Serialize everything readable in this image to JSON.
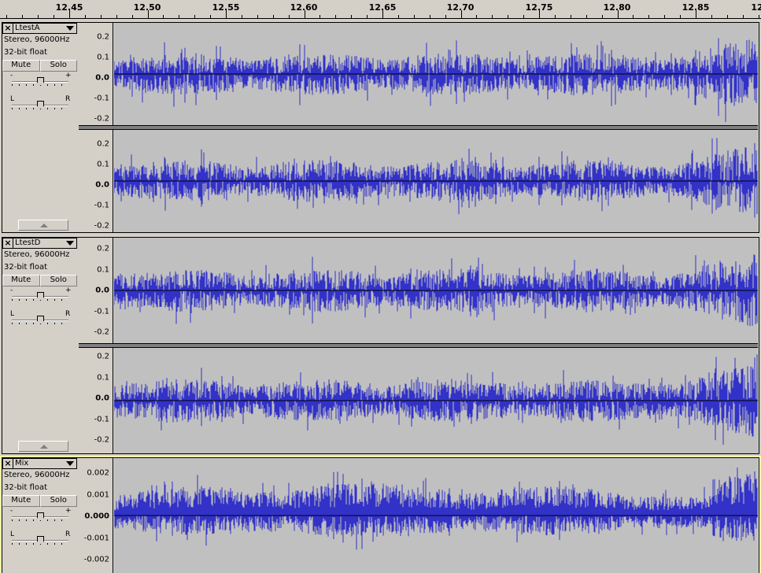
{
  "ruler": {
    "ticks": [
      "12.45",
      "12.50",
      "12.55",
      "12.60",
      "12.65",
      "12.70",
      "12.75",
      "12.80",
      "12.85",
      "12"
    ]
  },
  "tracks": [
    {
      "name": "LtestA",
      "info_line1": "Stereo, 96000Hz",
      "info_line2": "32-bit float",
      "mute_label": "Mute",
      "solo_label": "Solo",
      "gain_minus": "-",
      "gain_plus": "+",
      "pan_left": "L",
      "pan_right": "R",
      "channel_scale": [
        "0.2",
        "0.1",
        "0.0",
        "-0.1",
        "-0.2"
      ]
    },
    {
      "name": "LtestD",
      "info_line1": "Stereo, 96000Hz",
      "info_line2": "32-bit float",
      "mute_label": "Mute",
      "solo_label": "Solo",
      "gain_minus": "-",
      "gain_plus": "+",
      "pan_left": "L",
      "pan_right": "R",
      "channel_scale": [
        "0.2",
        "0.1",
        "0.0",
        "-0.1",
        "-0.2"
      ]
    },
    {
      "name": "Mix",
      "info_line1": "Stereo, 96000Hz",
      "info_line2": "32-bit float",
      "mute_label": "Mute",
      "solo_label": "Solo",
      "gain_minus": "-",
      "gain_plus": "+",
      "pan_left": "L",
      "pan_right": "R",
      "channel_scale": [
        "0.002",
        "0.001",
        "0.000",
        "-0.001",
        "-0.002"
      ]
    }
  ],
  "colors": {
    "waveform": "#3232c8",
    "wave_background": "#c0c0c0",
    "selected_track": "#ffffa8",
    "chrome": "#d4d0c8"
  },
  "icons": {
    "close": "close-icon",
    "menu": "chevron-down-icon",
    "collapse": "collapse-up-icon"
  }
}
